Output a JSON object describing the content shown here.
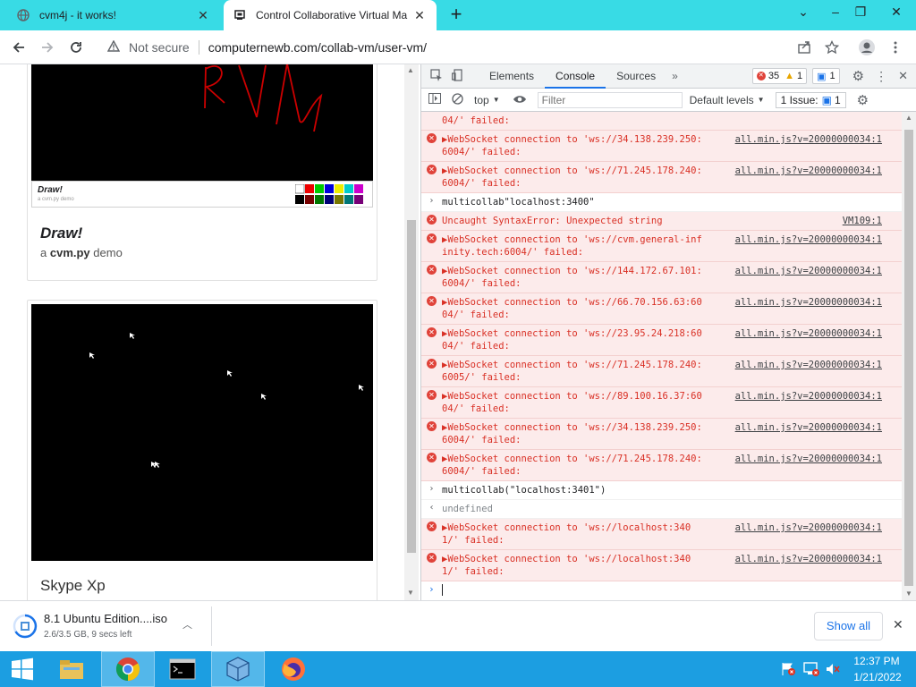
{
  "tabs": [
    {
      "title": "cvm4j - it works!"
    },
    {
      "title": "Control Collaborative Virtual Ma"
    }
  ],
  "address": {
    "security": "Not secure",
    "url": "computernewb.com/collab-vm/user-vm/"
  },
  "cards": [
    {
      "thumb_title": "Draw!",
      "thumb_sub": "a cvm.py demo",
      "title": "Draw!",
      "desc_prefix": "a",
      "desc_bold": "cvm.py",
      "desc_suffix": "demo",
      "scrawl": "RVN"
    },
    {
      "title": "Skype Xp"
    }
  ],
  "devtools": {
    "tabs": [
      "Elements",
      "Console",
      "Sources"
    ],
    "error_count": "35",
    "warn_count": "1",
    "info_count": "1",
    "context": "top",
    "filter_placeholder": "Filter",
    "levels": "Default levels",
    "issue_label": "1 Issue:",
    "issue_count": "1"
  },
  "console": [
    {
      "t": "err",
      "a": "04/' failed:",
      "noicon": true
    },
    {
      "t": "err",
      "a": "▶WebSocket connection to 'ws://34.138.239.250:",
      "b": "6004/' failed:",
      "src": "all.min.js?v=20000000034:1"
    },
    {
      "t": "err",
      "a": "▶WebSocket connection to 'ws://71.245.178.240:",
      "b": "6004/' failed:",
      "src": "all.min.js?v=20000000034:1"
    },
    {
      "t": "cmd",
      "a": "multicollab\"localhost:3400\""
    },
    {
      "t": "err",
      "a": "Uncaught SyntaxError: Unexpected string",
      "src": "VM109:1"
    },
    {
      "t": "err",
      "a": "▶WebSocket connection to 'ws://cvm.general-inf",
      "b": "inity.tech:6004/' failed:",
      "src": "all.min.js?v=20000000034:1"
    },
    {
      "t": "err",
      "a": "▶WebSocket connection to 'ws://144.172.67.101:",
      "b": "6004/' failed:",
      "src": "all.min.js?v=20000000034:1"
    },
    {
      "t": "err",
      "a": "▶WebSocket connection to 'ws://66.70.156.63:60",
      "b": "04/' failed:",
      "src": "all.min.js?v=20000000034:1"
    },
    {
      "t": "err",
      "a": "▶WebSocket connection to 'ws://23.95.24.218:60",
      "b": "04/' failed:",
      "src": "all.min.js?v=20000000034:1"
    },
    {
      "t": "err",
      "a": "▶WebSocket connection to 'ws://71.245.178.240:",
      "b": "6005/' failed:",
      "src": "all.min.js?v=20000000034:1"
    },
    {
      "t": "err",
      "a": "▶WebSocket connection to 'ws://89.100.16.37:60",
      "b": "04/' failed:",
      "src": "all.min.js?v=20000000034:1"
    },
    {
      "t": "err",
      "a": "▶WebSocket connection to 'ws://34.138.239.250:",
      "b": "6004/' failed:",
      "src": "all.min.js?v=20000000034:1"
    },
    {
      "t": "err",
      "a": "▶WebSocket connection to 'ws://71.245.178.240:",
      "b": "6004/' failed:",
      "src": "all.min.js?v=20000000034:1"
    },
    {
      "t": "cmd",
      "a": "multicollab(\"localhost:3401\")"
    },
    {
      "t": "res",
      "a": "undefined"
    },
    {
      "t": "err",
      "a": "▶WebSocket connection to 'ws://localhost:340",
      "b": "1/' failed:",
      "src": "all.min.js?v=20000000034:1"
    },
    {
      "t": "err",
      "a": "▶WebSocket connection to 'ws://localhost:340",
      "b": "1/' failed:",
      "src": "all.min.js?v=20000000034:1"
    }
  ],
  "download": {
    "filename": "8.1 Ubuntu Edition....iso",
    "progress": "2.6/3.5 GB, 9 secs left",
    "show_all": "Show all"
  },
  "taskbar": {
    "time": "12:37 PM",
    "date": "1/21/2022"
  },
  "colors": {
    "tabstrip": "#38dbe5",
    "taskbar": "#1c9ee1",
    "error_bg": "#fcebeb",
    "error_text": "#d93025",
    "accent": "#1a73e8"
  }
}
